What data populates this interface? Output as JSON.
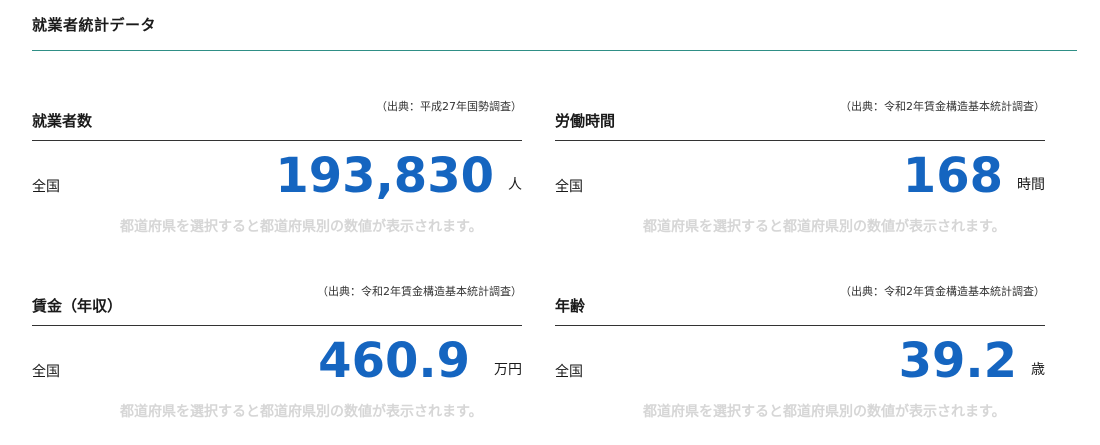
{
  "page": {
    "title": "就業者統計データ"
  },
  "cards": [
    {
      "title": "就業者数",
      "source": "（出典：平成27年国勢調査）",
      "region": "全国",
      "value": "193,830",
      "unit": "人",
      "note": "都道府県を選択すると都道府県別の数値が表示されます。"
    },
    {
      "title": "労働時間",
      "source": "（出典：令和2年賃金構造基本統計調査）",
      "region": "全国",
      "value": "168",
      "unit": "時間",
      "note": "都道府県を選択すると都道府県別の数値が表示されます。"
    },
    {
      "title": "賃金（年収）",
      "source": "（出典：令和2年賃金構造基本統計調査）",
      "region": "全国",
      "value": "460.9",
      "unit": "万円",
      "note": "都道府県を選択すると都道府県別の数値が表示されます。"
    },
    {
      "title": "年齢",
      "source": "（出典：令和2年賃金構造基本統計調査）",
      "region": "全国",
      "value": "39.2",
      "unit": "歳",
      "note": "都道府県を選択すると都道府県別の数値が表示されます。"
    }
  ]
}
